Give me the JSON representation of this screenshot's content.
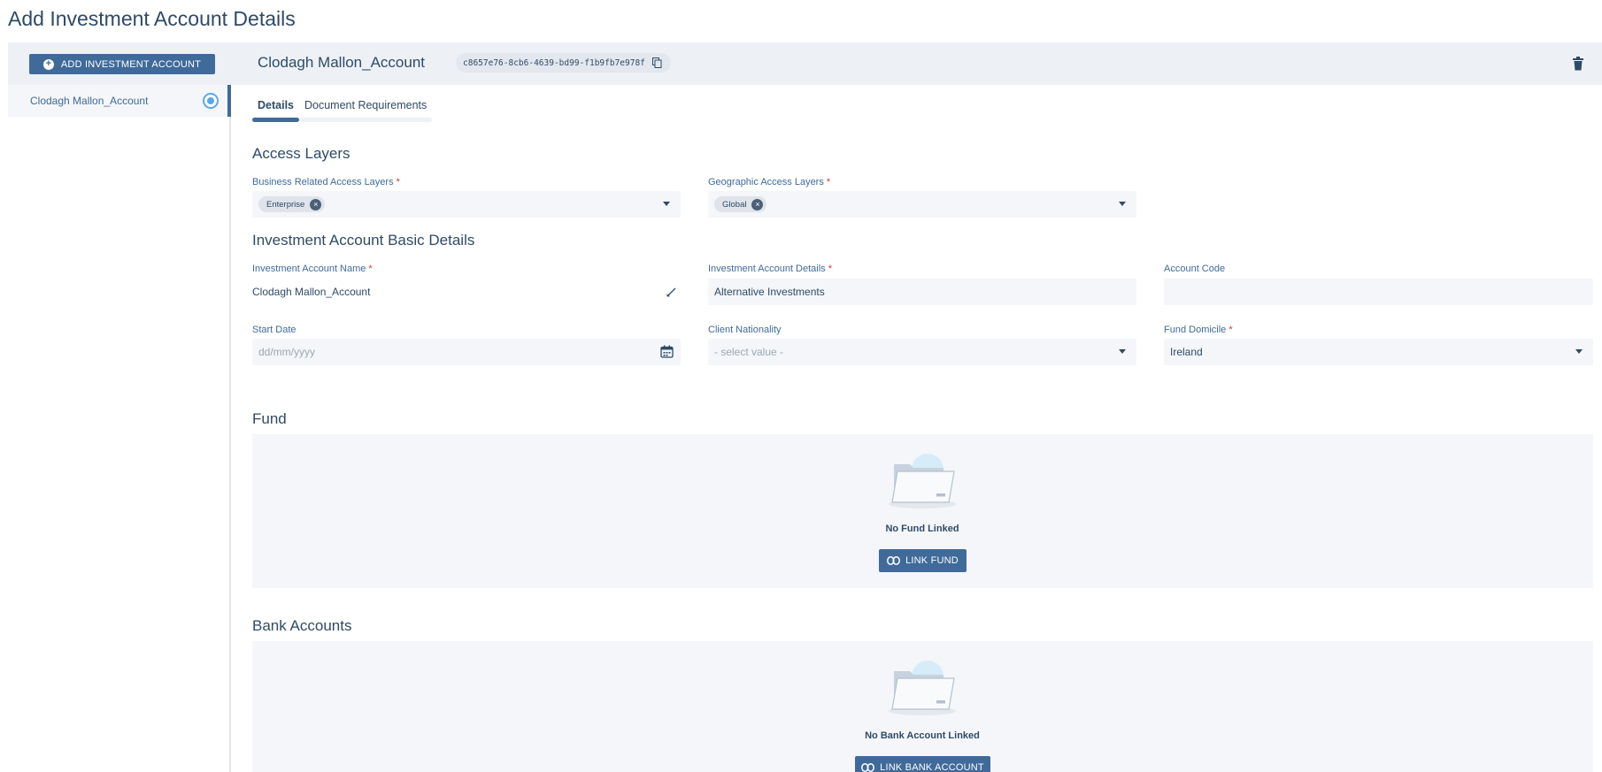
{
  "page": {
    "title": "Add Investment Account Details"
  },
  "toolbar": {
    "add_label": "ADD INVESTMENT ACCOUNT",
    "account_title": "Clodagh Mallon_Account",
    "uuid": "c8657e76-8cb6-4639-bd99-f1b9fb7e978f"
  },
  "sidebar": {
    "items": [
      {
        "label": "Clodagh Mallon_Account",
        "selected": true
      }
    ]
  },
  "tabs": [
    {
      "label": "Details",
      "active": true
    },
    {
      "label": "Document Requirements",
      "active": false
    }
  ],
  "access_layers": {
    "heading": "Access Layers",
    "business": {
      "label": "Business Related Access Layers",
      "chips": [
        "Enterprise"
      ]
    },
    "geographic": {
      "label": "Geographic Access Layers",
      "chips": [
        "Global"
      ]
    }
  },
  "basic": {
    "heading": "Investment Account Basic Details",
    "name": {
      "label": "Investment Account Name",
      "value": "Clodagh Mallon_Account"
    },
    "details": {
      "label": "Investment Account Details",
      "value": "Alternative Investments"
    },
    "code": {
      "label": "Account Code",
      "value": ""
    },
    "start_date": {
      "label": "Start Date",
      "placeholder": "dd/mm/yyyy"
    },
    "nationality": {
      "label": "Client Nationality",
      "placeholder": "- select value -"
    },
    "domicile": {
      "label": "Fund Domicile",
      "value": "Ireland"
    }
  },
  "fund": {
    "heading": "Fund",
    "empty_text": "No Fund Linked",
    "button": "LINK FUND"
  },
  "bank": {
    "heading": "Bank Accounts",
    "empty_text": "No Bank Account Linked",
    "button": "LINK BANK ACCOUNT"
  },
  "colors": {
    "primary": "#3f6a9a",
    "text": "#2f4a66",
    "surface": "#f4f6f9",
    "band": "#edf1f6",
    "required": "#dd3333"
  },
  "required_mark": "*"
}
